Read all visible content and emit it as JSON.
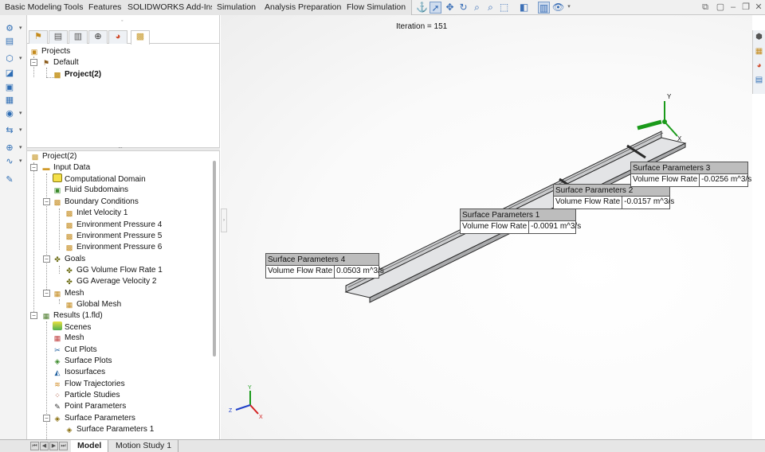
{
  "ribbon": {
    "tabs": [
      "Basic Modeling Tools",
      "Features",
      "SOLIDWORKS Add-Ins",
      "Simulation",
      "Analysis Preparation",
      "Flow Simulation"
    ]
  },
  "projects_tree": {
    "root": "Projects",
    "config": "Default",
    "project": "Project(2)"
  },
  "analysis_tree": {
    "root": "Project(2)",
    "input_data": "Input Data",
    "computational_domain": "Computational Domain",
    "fluid_subdomains": "Fluid Subdomains",
    "boundary_conditions": "Boundary Conditions",
    "bc_items": [
      "Inlet Velocity 1",
      "Environment Pressure 4",
      "Environment Pressure 5",
      "Environment Pressure 6"
    ],
    "goals": "Goals",
    "goal_items": [
      "GG Volume Flow Rate 1",
      "GG Average Velocity 2"
    ],
    "mesh": "Mesh",
    "global_mesh": "Global Mesh",
    "results": "Results (1.fld)",
    "result_items": [
      "Scenes",
      "Mesh",
      "Cut Plots",
      "Surface Plots",
      "Isosurfaces",
      "Flow Trajectories",
      "Particle Studies",
      "Point Parameters",
      "Surface Parameters"
    ],
    "surface_parameters_child": "Surface Parameters 1"
  },
  "viewport": {
    "iteration_label": "Iteration = 151",
    "callouts": [
      {
        "title": "Surface Parameters 4",
        "label": "Volume Flow Rate",
        "value": "0.0503 m^3/s"
      },
      {
        "title": "Surface Parameters 1",
        "label": "Volume Flow Rate",
        "value": "-0.0091 m^3/s"
      },
      {
        "title": "Surface Parameters 2",
        "label": "Volume Flow Rate",
        "value": "-0.0157 m^3/s"
      },
      {
        "title": "Surface Parameters 3",
        "label": "Volume Flow Rate",
        "value": "-0.0256 m^3/s"
      }
    ],
    "triad_axes": {
      "x": "X",
      "y": "Y",
      "z": "Z"
    },
    "model_triad_axes": {
      "y": "Y",
      "x": "X"
    }
  },
  "bottom_tabs": {
    "model": "Model",
    "motion_study": "Motion Study 1"
  },
  "colors": {
    "callout_header": "#bdbdbd",
    "selection_blue": "#cfdcee",
    "axis_x": "#d32020",
    "axis_y": "#1a9a1a",
    "axis_z": "#2040c8"
  }
}
